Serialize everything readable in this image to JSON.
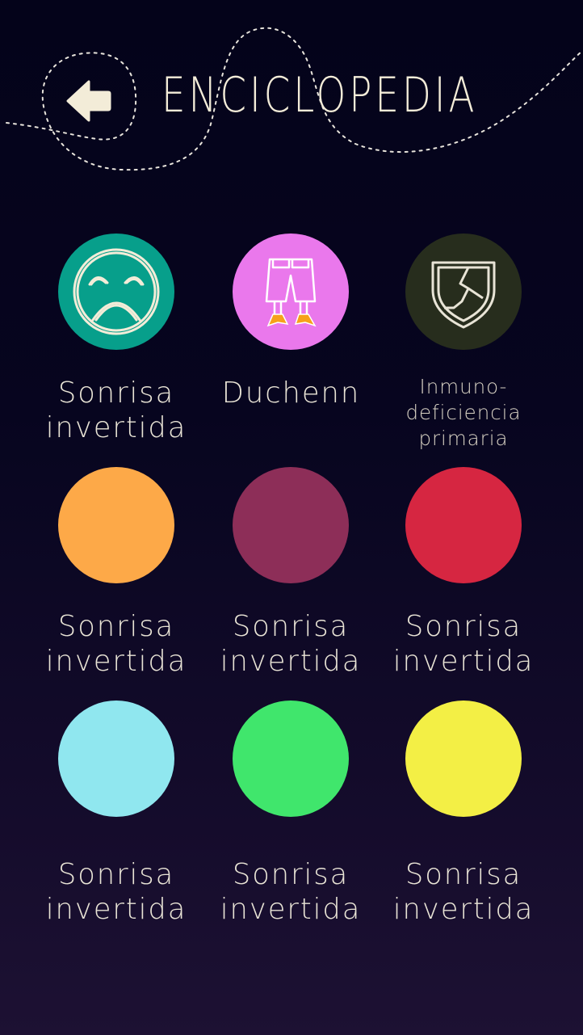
{
  "header": {
    "title": "ENCICLOPEDIA",
    "back_icon": "arrow-left-icon"
  },
  "items": [
    {
      "lines": [
        "Sonrisa",
        "invertida"
      ],
      "color": "#079f8b",
      "icon": "sad-face-icon"
    },
    {
      "lines": [
        "Duchenn"
      ],
      "color": "#ea78ec",
      "icon": "shorts-legs-icon"
    },
    {
      "lines": [
        "Inmuno-",
        "deficiencia",
        "primaria"
      ],
      "color": "#272d1d",
      "icon": "cracked-shield-icon"
    },
    {
      "lines": [
        "Sonrisa",
        "invertida"
      ],
      "color": "#fda948"
    },
    {
      "lines": [
        "Sonrisa",
        "invertida"
      ],
      "color": "#8d2e58"
    },
    {
      "lines": [
        "Sonrisa",
        "invertida"
      ],
      "color": "#d62641"
    },
    {
      "lines": [
        "Sonrisa",
        "invertida"
      ],
      "color": "#90e7ef"
    },
    {
      "lines": [
        "Sonrisa",
        "invertida"
      ],
      "color": "#40e66c"
    },
    {
      "lines": [
        "Sonrisa",
        "invertida"
      ],
      "color": "#f3ef45"
    }
  ]
}
